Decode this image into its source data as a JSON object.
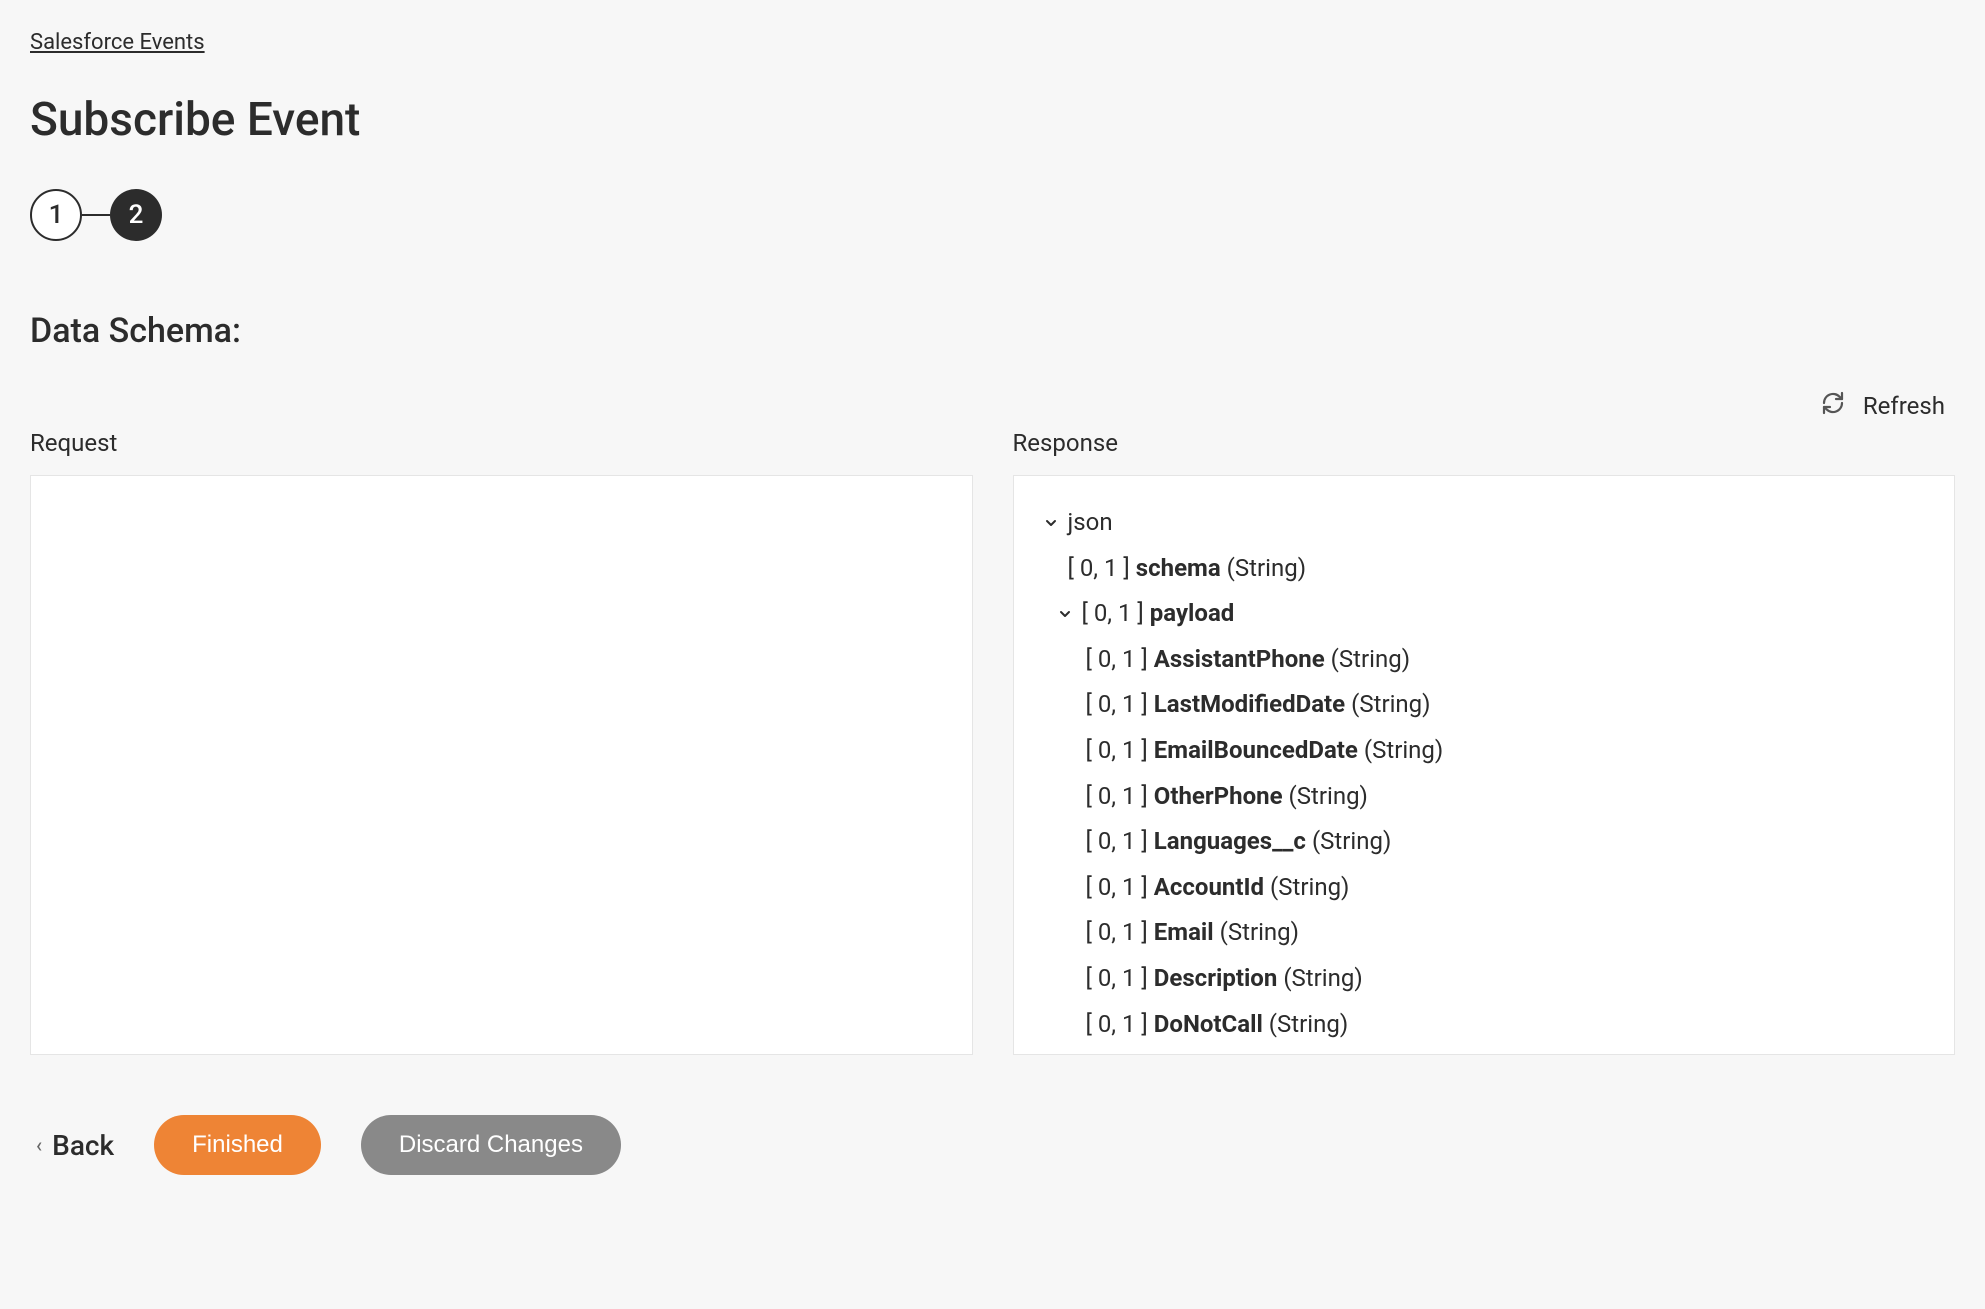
{
  "breadcrumb": {
    "label": "Salesforce Events"
  },
  "page": {
    "title": "Subscribe Event"
  },
  "steps": [
    {
      "label": "1",
      "active": false
    },
    {
      "label": "2",
      "active": true
    }
  ],
  "section": {
    "title": "Data Schema:"
  },
  "refresh": {
    "label": "Refresh"
  },
  "request": {
    "header": "Request"
  },
  "response": {
    "header": "Response",
    "tree": {
      "root": {
        "name": "json"
      },
      "schema": {
        "cardinality": "[ 0, 1 ]",
        "name": "schema",
        "type": "(String)"
      },
      "payload": {
        "cardinality": "[ 0, 1 ]",
        "name": "payload"
      },
      "fields": [
        {
          "cardinality": "[ 0, 1 ]",
          "name": "AssistantPhone",
          "type": "(String)"
        },
        {
          "cardinality": "[ 0, 1 ]",
          "name": "LastModifiedDate",
          "type": "(String)"
        },
        {
          "cardinality": "[ 0, 1 ]",
          "name": "EmailBouncedDate",
          "type": "(String)"
        },
        {
          "cardinality": "[ 0, 1 ]",
          "name": "OtherPhone",
          "type": "(String)"
        },
        {
          "cardinality": "[ 0, 1 ]",
          "name": "Languages__c",
          "type": "(String)"
        },
        {
          "cardinality": "[ 0, 1 ]",
          "name": "AccountId",
          "type": "(String)"
        },
        {
          "cardinality": "[ 0, 1 ]",
          "name": "Email",
          "type": "(String)"
        },
        {
          "cardinality": "[ 0, 1 ]",
          "name": "Description",
          "type": "(String)"
        },
        {
          "cardinality": "[ 0, 1 ]",
          "name": "DoNotCall",
          "type": "(String)"
        }
      ]
    }
  },
  "footer": {
    "back": "Back",
    "finished": "Finished",
    "discard": "Discard Changes"
  }
}
